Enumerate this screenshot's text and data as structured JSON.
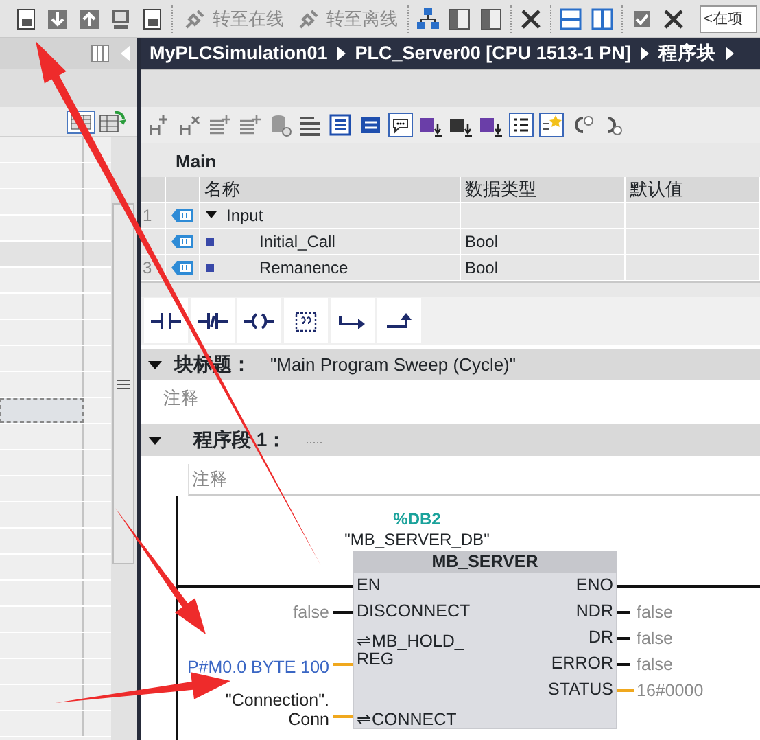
{
  "toolbar": {
    "buttons": [
      {
        "label": "转至在线",
        "disabled": true
      },
      {
        "label": "转至离线",
        "disabled": true
      }
    ],
    "search": {
      "placeholder": "<在项"
    }
  },
  "breadcrumb": [
    "MyPLCSimulation01",
    "PLC_Server00 [CPU 1513-1 PN]",
    "程序块"
  ],
  "interface": {
    "title": "Main",
    "columns": [
      "名称",
      "数据类型",
      "默认值"
    ],
    "rows": [
      {
        "number": "1",
        "kind": "section",
        "name": "Input",
        "type": "",
        "expanded": true
      },
      {
        "kind": "member",
        "name": "Initial_Call",
        "type": "Bool"
      },
      {
        "number": "3",
        "kind": "member",
        "name": "Remanence",
        "type": "Bool"
      }
    ]
  },
  "block_title": {
    "label": "块标题：",
    "value": "\"Main Program Sweep (Cycle)\"",
    "expanded": true,
    "comment": "注释"
  },
  "network": {
    "label": "程序段 1：",
    "title": ".....",
    "expanded": true,
    "comment": "注释",
    "instance_address": "%DB2",
    "instance_name": "\"MB_SERVER_DB\"",
    "block": {
      "name": "MB_SERVER",
      "inputs": [
        {
          "pin": "EN",
          "kind": "power"
        },
        {
          "pin": "DISCONNECT",
          "kind": "bool",
          "param": "false"
        },
        {
          "pin": "⇌MB_HOLD_\nREG",
          "kind": "address",
          "param": "P#M0.0 BYTE 100"
        },
        {
          "pin": "⇌CONNECT",
          "kind": "tag",
          "param": "\"Connection\".\nConn"
        }
      ],
      "outputs": [
        {
          "pin": "ENO",
          "kind": "power"
        },
        {
          "pin": "NDR",
          "kind": "bool",
          "param": "false"
        },
        {
          "pin": "DR",
          "kind": "bool",
          "param": "false"
        },
        {
          "pin": "ERROR",
          "kind": "bool",
          "param": "false"
        },
        {
          "pin": "STATUS",
          "kind": "word",
          "param": "16#0000"
        }
      ]
    }
  }
}
